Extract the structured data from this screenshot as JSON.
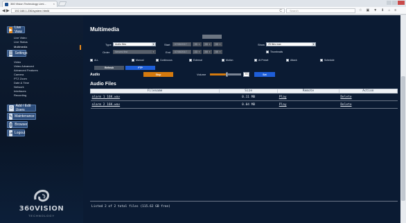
{
  "browser": {
    "tab_title": "360 Vision Technology Limi...",
    "tab_close": "×",
    "url": "192.168.1.236/system.html#",
    "search_placeholder": "Search",
    "nav_back": "◀",
    "nav_forward": "▶",
    "reload": "C",
    "toolbar_icons": [
      "☆",
      "▣",
      "▼",
      "⬇",
      "⌂",
      "≡"
    ]
  },
  "sidebar": {
    "live_view": "Live View",
    "live_links": [
      "Live Video",
      "Live Status",
      "Multimedia"
    ],
    "settings": "Settings",
    "settings_links": [
      "Video",
      "Video Advanced",
      "Advanced Features",
      "Camera",
      "PTZ Zoom",
      "Date & Time",
      "Network",
      "Interfaces",
      "Recording"
    ],
    "add_edit_users": "Add / Edit Users",
    "maintenance": "Maintenance",
    "browser": "Browser",
    "logout": "Logout",
    "logo_text": "360VISION",
    "logo_sub": "TECHNOLOGY"
  },
  "main": {
    "title": "Multimedia",
    "type_label": "Type",
    "type_value": "Audio files",
    "start_label": "Start",
    "start_date": "07/08/2017",
    "start_h": "00",
    "start_m": "00",
    "start_s": "00",
    "show_label": "Show",
    "show_value": "25 files max",
    "order_label": "Order",
    "order_value": "Newest first",
    "end_label": "End",
    "end_date": "07/08/2017",
    "end_h": "23",
    "end_m": "59",
    "end_s": "59",
    "thumbnails_label": "Thumbnails",
    "filters": [
      "ALL",
      "Manual",
      "Continuous",
      "External",
      "Motion",
      "At Preset",
      "Attack",
      "Schedule"
    ],
    "refresh_label": "Refresh",
    "ftp_label": "FTP",
    "audio_label": "Audio",
    "stop_label": "Stop",
    "volume_label": "Volume",
    "volume_value": "70",
    "volume_level": 0.55,
    "set_label": "Set",
    "files_title": "Audio Files",
    "columns": [
      "Filename",
      "Size",
      "Remote",
      "Action"
    ],
    "rows": [
      {
        "filename": "alarm 1 16K.wav",
        "size": "0.11 MB",
        "remote": "Play",
        "action": "Delete"
      },
      {
        "filename": "alarm 2 16K.wav",
        "size": "0.04 MB",
        "remote": "Play",
        "action": "Delete"
      }
    ],
    "footer": "Listed 2 of 2 total files (115.62 GB free)"
  },
  "colors": {
    "accent_orange": "#d57a0e",
    "accent_blue": "#1e5ed8",
    "panel_bg": "#0b1b33"
  }
}
